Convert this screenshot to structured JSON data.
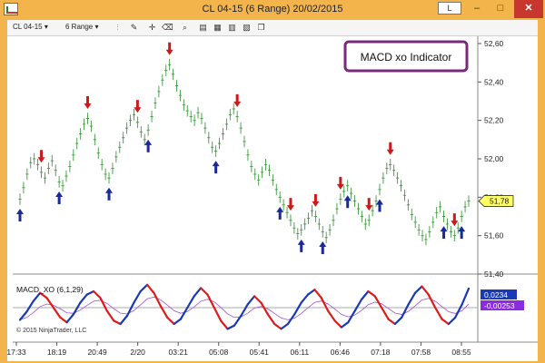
{
  "window": {
    "title": "CL 04-15 (6 Range)  20/02/2015",
    "btn_custom": "L",
    "btn_min": "–",
    "btn_max": "□",
    "btn_close": "✕"
  },
  "toolbar": {
    "instrument": "CL 04-15",
    "period": "6 Range",
    "icons": [
      "bar-type-icon",
      "draw-pencil-icon",
      "crosshair-icon",
      "eraser-icon",
      "zoom-icon",
      "properties-icon",
      "strategies-icon",
      "templates-icon",
      "data-box-icon",
      "copy-icon"
    ]
  },
  "annotation": {
    "label": "MACD xo Indicator",
    "border_color": "#7a2a7a"
  },
  "price_panel": {
    "y_ticks": [
      "52,60",
      "52,40",
      "52,20",
      "52,00",
      "51,80",
      "51,60",
      "51,40"
    ],
    "last_price": "51,78",
    "last_price_color": "#ffff66"
  },
  "macd_panel": {
    "label": "MACD_XO (6,1,29)",
    "value_positive": "0,0234",
    "value_negative": "-0,00253",
    "positive_color": "#1a3ab5",
    "negative_color": "#8a2be2"
  },
  "copyright": "© 2015 NinjaTrader, LLC",
  "x_ticks": [
    "17:33",
    "18:19",
    "20:49",
    "2/20",
    "03:21",
    "05:08",
    "05:41",
    "06:11",
    "06:46",
    "07:18",
    "07:58",
    "08:55"
  ],
  "chart_data": {
    "type": "line",
    "ylim": [
      51.4,
      52.6
    ],
    "price_series": [
      51.79,
      51.85,
      51.92,
      51.98,
      52.0,
      51.97,
      51.93,
      51.9,
      51.95,
      51.99,
      51.94,
      51.88,
      51.86,
      51.91,
      51.96,
      52.02,
      52.08,
      52.13,
      52.18,
      52.21,
      52.17,
      52.1,
      52.03,
      51.97,
      51.92,
      51.9,
      51.95,
      52.01,
      52.06,
      52.11,
      52.16,
      52.2,
      52.23,
      52.19,
      52.14,
      52.1,
      52.15,
      52.22,
      52.29,
      52.35,
      52.41,
      52.46,
      52.49,
      52.44,
      52.38,
      52.33,
      52.28,
      52.25,
      52.22,
      52.2,
      52.24,
      52.21,
      52.16,
      52.11,
      52.06,
      52.04,
      52.08,
      52.13,
      52.18,
      52.23,
      52.26,
      52.22,
      52.16,
      52.09,
      52.02,
      51.96,
      51.92,
      51.89,
      51.93,
      51.97,
      51.94,
      51.89,
      51.84,
      51.8,
      51.76,
      51.72,
      51.68,
      51.64,
      51.61,
      51.63,
      51.66,
      51.69,
      51.73,
      51.7,
      51.66,
      51.62,
      51.59,
      51.63,
      51.68,
      51.74,
      51.79,
      51.83,
      51.86,
      51.82,
      51.78,
      51.74,
      51.7,
      51.66,
      51.68,
      51.73,
      51.78,
      51.84,
      51.9,
      51.95,
      51.97,
      51.94,
      51.9,
      51.86,
      51.81,
      51.76,
      51.71,
      51.67,
      51.63,
      51.6,
      51.58,
      51.62,
      51.67,
      51.72,
      51.75,
      51.7,
      51.66,
      51.62,
      51.6,
      51.64,
      51.7,
      51.75,
      51.78
    ],
    "sell_arrow_indices": [
      6,
      19,
      33,
      42,
      61,
      76,
      83,
      90,
      98,
      104,
      122
    ],
    "buy_arrow_indices": [
      0,
      11,
      25,
      36,
      55,
      73,
      79,
      85,
      92,
      101,
      119,
      124
    ],
    "macd_series": [
      -0.015,
      -0.005,
      0.008,
      0.018,
      0.012,
      0.0,
      -0.012,
      -0.018,
      -0.008,
      0.006,
      0.016,
      0.02,
      0.012,
      -0.004,
      -0.016,
      -0.02,
      -0.01,
      0.006,
      0.02,
      0.028,
      0.018,
      0.002,
      -0.012,
      -0.02,
      -0.014,
      0.0,
      0.014,
      0.024,
      0.016,
      0.0,
      -0.016,
      -0.026,
      -0.022,
      -0.01,
      0.004,
      0.014,
      0.006,
      -0.008,
      -0.02,
      -0.026,
      -0.02,
      -0.008,
      0.006,
      0.016,
      0.022,
      0.012,
      -0.004,
      -0.016,
      -0.024,
      -0.018,
      -0.004,
      0.01,
      0.02,
      0.014,
      0.0,
      -0.014,
      -0.02,
      -0.012,
      0.004,
      0.018,
      0.026,
      0.016,
      0.0,
      -0.014,
      -0.02,
      -0.012,
      0.004,
      0.0234
    ]
  }
}
